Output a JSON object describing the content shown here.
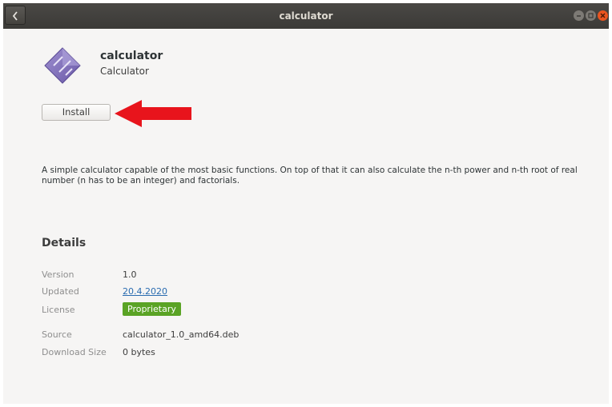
{
  "window": {
    "title": "calculator"
  },
  "app": {
    "name": "calculator",
    "summary": "Calculator",
    "install_label": "Install",
    "description": "A simple calculator capable of the most basic functions. On top of that it can also calculate the n-th power and n-th root of real number (n has to be an integer) and factorials."
  },
  "details": {
    "heading": "Details",
    "rows": [
      {
        "label": "Version",
        "value": "1.0"
      },
      {
        "label": "Updated",
        "value": "20.4.2020"
      },
      {
        "label": "License",
        "value": "Proprietary"
      },
      {
        "label": "Source",
        "value": "calculator_1.0_amd64.deb"
      },
      {
        "label": "Download Size",
        "value": "0 bytes"
      }
    ]
  },
  "icons": {
    "back": "chevron-left-icon",
    "app": "calculator-app-icon",
    "annotation": "red-arrow-left-icon"
  },
  "colors": {
    "titlebar": "#3c3b37",
    "close": "#e95420",
    "license_badge": "#5aa325",
    "link": "#2a6cb0",
    "annotation_arrow": "#e8141c"
  }
}
